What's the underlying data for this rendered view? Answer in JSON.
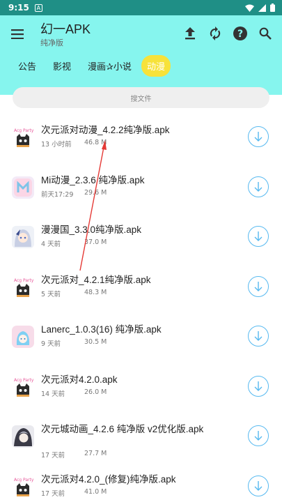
{
  "status": {
    "time": "9:15",
    "badge": "A"
  },
  "header": {
    "title": "幻一APK",
    "subtitle": "纯净版"
  },
  "tabs": [
    {
      "label": "公告"
    },
    {
      "label": "影视"
    },
    {
      "label": "漫画✰小说"
    },
    {
      "label": "动漫"
    }
  ],
  "search": {
    "placeholder": "搜文件"
  },
  "files": [
    {
      "name": "次元派对动漫_4.2.2纯净版.apk",
      "time": "13 小时前",
      "size": "46.8 M",
      "icon": "acg-party-cat-icon"
    },
    {
      "name": "Mi动漫_2.3.6 纯净版.apk",
      "time": "前天17:29",
      "size": "29.6 M",
      "icon": "mi-anime-icon"
    },
    {
      "name": "漫漫国_3.3.0纯净版.apk",
      "time": "4 天前",
      "size": "37.0 M",
      "icon": "anime-girl-icon"
    },
    {
      "name": "次元派对_4.2.1纯净版.apk",
      "time": "5 天前",
      "size": "48.3 M",
      "icon": "acg-party-cat-icon"
    },
    {
      "name": "Lanerc_1.0.3(16) 纯净版.apk",
      "time": "9 天前",
      "size": "30.5 M",
      "icon": "lanerc-icon"
    },
    {
      "name": "次元派对4.2.0.apk",
      "time": "14 天前",
      "size": "26.0 M",
      "icon": "acg-party-cat-icon"
    },
    {
      "name": "次元城动画_4.2.6 纯净版 v2优化版.apk",
      "time": "17 天前",
      "size": "27.7 M",
      "icon": "anime-character-icon"
    },
    {
      "name": "次元派对4.2.0_(修复)纯净版.apk",
      "time": "17 天前",
      "size": "41.0 M",
      "icon": "acg-party-cat-icon"
    }
  ],
  "colors": {
    "status_bar": "#1f8f86",
    "app_bar": "#86f5ee",
    "active_tab": "#f7e23a",
    "download": "#56b9f0",
    "arrow": "#e53935"
  }
}
